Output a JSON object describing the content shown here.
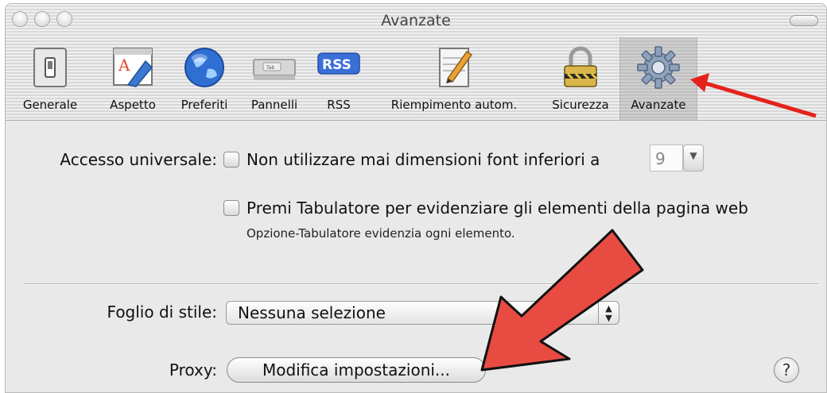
{
  "window": {
    "title": "Avanzate"
  },
  "toolbar": {
    "items": [
      {
        "label": "Generale",
        "icon": "general-switch-icon"
      },
      {
        "label": "Aspetto",
        "icon": "appearance-icon"
      },
      {
        "label": "Preferiti",
        "icon": "globe-icon"
      },
      {
        "label": "Pannelli",
        "icon": "tabs-icon"
      },
      {
        "label": "RSS",
        "icon": "rss-icon"
      },
      {
        "label": "Riempimento autom.",
        "icon": "autofill-pencil-icon"
      },
      {
        "label": "Sicurezza",
        "icon": "lock-icon"
      },
      {
        "label": "Avanzate",
        "icon": "gear-icon",
        "selected": true
      }
    ]
  },
  "accessibility": {
    "label": "Accesso universale:",
    "min_font_option": "Non utilizzare mai dimensioni font inferiori a",
    "min_font_value": "9",
    "tab_option": "Premi Tabulatore per evidenziare gli elementi della pagina web",
    "tab_hint": "Opzione-Tabulatore evidenzia ogni elemento."
  },
  "stylesheet": {
    "label": "Foglio di stile:",
    "value": "Nessuna selezione"
  },
  "proxy": {
    "label": "Proxy:",
    "button": "Modifica impostazioni..."
  },
  "help": {
    "symbol": "?"
  },
  "annotations": {
    "arrow_color": "#e4221b"
  }
}
